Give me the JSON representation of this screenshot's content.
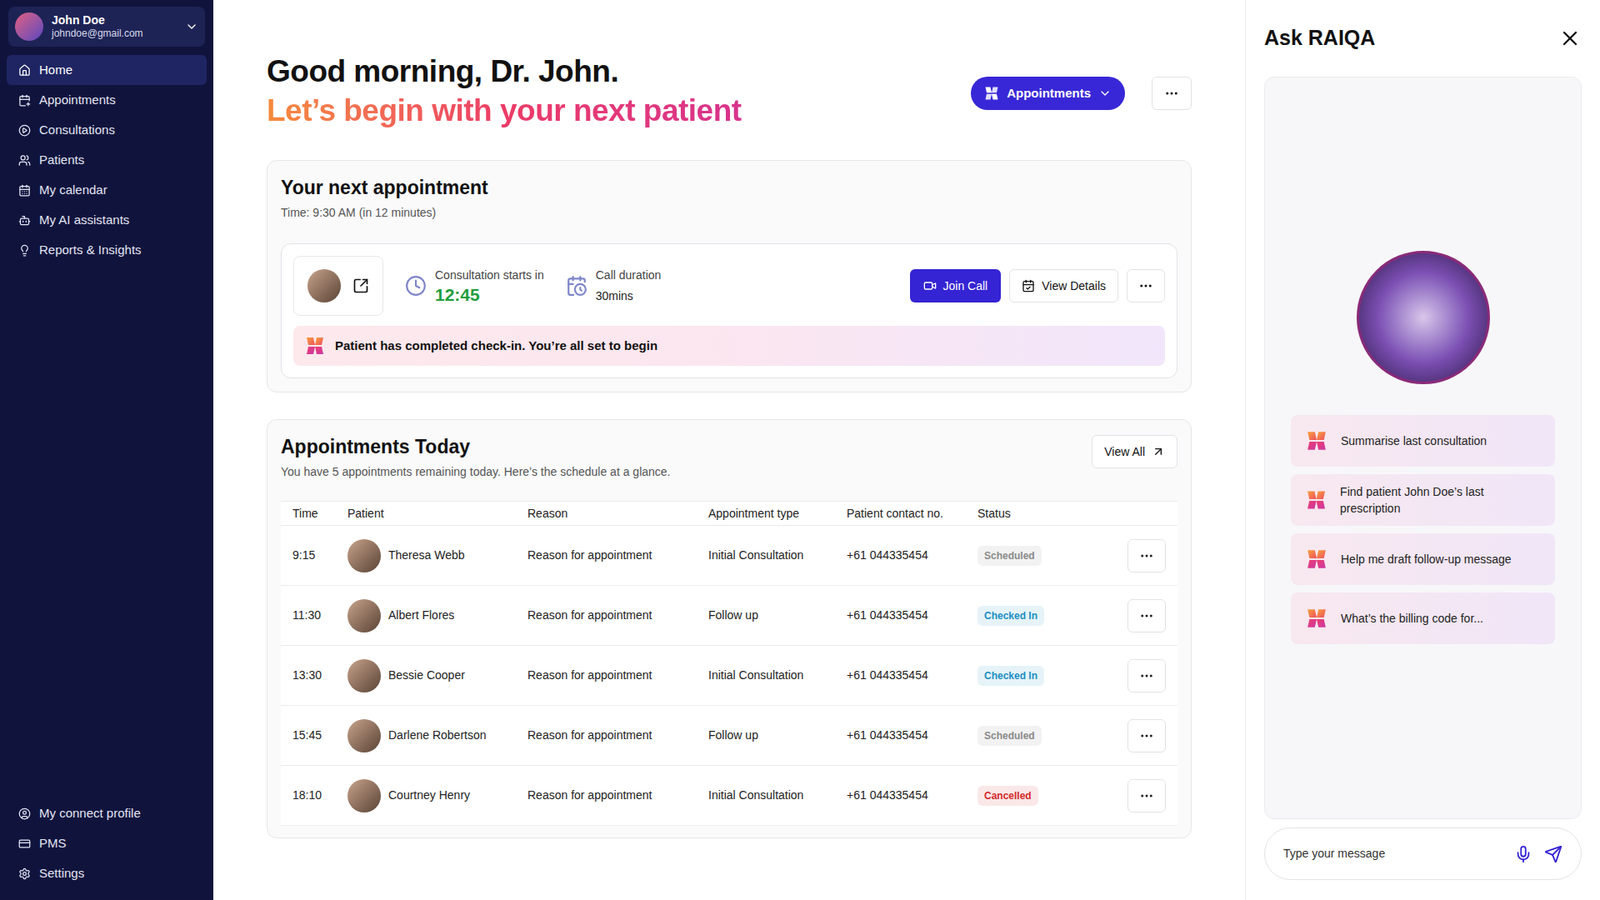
{
  "user": {
    "name": "John Doe",
    "email": "johndoe@gmail.com"
  },
  "sidebar": {
    "items": [
      {
        "label": "Home",
        "selected": true
      },
      {
        "label": "Appointments",
        "selected": false
      },
      {
        "label": "Consultations",
        "selected": false
      },
      {
        "label": "Patients",
        "selected": false
      },
      {
        "label": "My calendar",
        "selected": false
      },
      {
        "label": "My AI assistants",
        "selected": false
      },
      {
        "label": "Reports & Insights",
        "selected": false
      }
    ],
    "bottom_items": [
      {
        "label": "My connect profile",
        "selected": false
      },
      {
        "label": "PMS",
        "selected": false
      },
      {
        "label": "Settings",
        "selected": false
      }
    ]
  },
  "header": {
    "greeting": "Good morning, Dr. John.",
    "subtitle": "Let’s begin with your next patient",
    "appointments_button": "Appointments"
  },
  "next_appointment": {
    "title": "Your next appointment",
    "time": "Time: 9:30 AM (in 12 minutes)",
    "countdown_label": "Consultation starts in",
    "countdown": "12:45",
    "duration_label": "Call duration",
    "duration": "30mins",
    "join_button": "Join Call",
    "details_button": "View Details",
    "checkin_message": "Patient has completed check-in. You’re all set to begin"
  },
  "appointments_today": {
    "title": "Appointments Today",
    "subtitle": "You have 5 appointments remaining today. Here’s the schedule at a glance.",
    "view_all": "View All",
    "columns": [
      "Time",
      "Patient",
      "Reason",
      "Appointment type",
      "Patient contact no.",
      "Status"
    ],
    "rows": [
      {
        "time": "9:15",
        "patient": "Theresa Webb",
        "reason": "Reason for appointment",
        "type": "Initial Consultation",
        "contact": "+61 044335454",
        "status": "Scheduled",
        "color": "#8a8a8a"
      },
      {
        "time": "11:30",
        "patient": "Albert Flores",
        "reason": "Reason for appointment",
        "type": "Follow up",
        "contact": "+61 044335454",
        "status": "Checked In",
        "color": "#1c8fc2"
      },
      {
        "time": "13:30",
        "patient": "Bessie Cooper",
        "reason": "Reason for appointment",
        "type": "Initial Consultation",
        "contact": "+61 044335454",
        "status": "Checked In",
        "color": "#1c8fc2"
      },
      {
        "time": "15:45",
        "patient": "Darlene Robertson",
        "reason": "Reason for appointment",
        "type": "Follow up",
        "contact": "+61 044335454",
        "status": "Scheduled",
        "color": "#8a8a8a"
      },
      {
        "time": "18:10",
        "patient": "Courtney Henry",
        "reason": "Reason for appointment",
        "type": "Initial Consultation",
        "contact": "+61 044335454",
        "status": "Cancelled",
        "color": "#d42a2a"
      }
    ]
  },
  "assistant": {
    "title": "Ask RAIQA",
    "suggestions": [
      "Summarise last consultation",
      "Find patient John Doe’s last prescription",
      "Help me draft follow-up message",
      "What’s the billing code for..."
    ],
    "input_placeholder": "Type your message"
  }
}
